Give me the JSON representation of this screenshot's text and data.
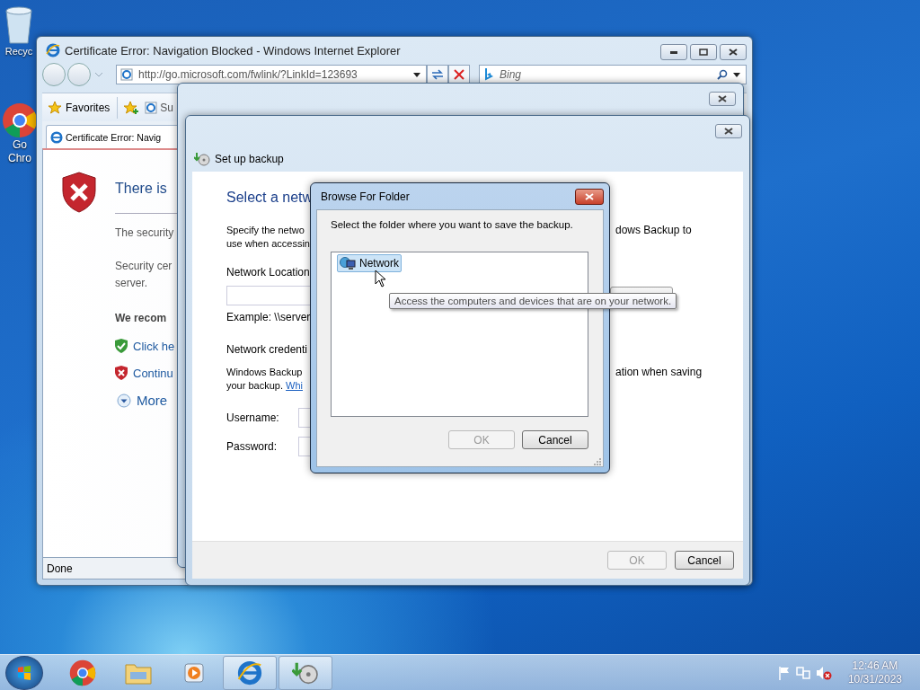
{
  "desktop": {
    "icons": [
      {
        "kind": "recycle",
        "lines": [
          "Recyc"
        ]
      },
      {
        "kind": "chrome",
        "lines": [
          "Go",
          "Chro"
        ]
      }
    ]
  },
  "browser": {
    "title": "Certificate Error: Navigation Blocked - Windows Internet Explorer",
    "address": "http://go.microsoft.com/fwlink/?LinkId=123693",
    "search": {
      "placeholder": "Bing"
    },
    "favorites": "Favorites",
    "favorites_items": [
      "Su"
    ],
    "tabs": [
      {
        "label": "Certificate Error: Navig",
        "selected": true
      }
    ],
    "page": {
      "heading": "There is",
      "paragraphs": [
        [
          "The security"
        ],
        [
          "Security cer",
          "server."
        ]
      ],
      "recommend": "We recom",
      "options": [
        {
          "kind": "safe",
          "text": "Click he"
        },
        {
          "kind": "unsafe",
          "text": "Continu"
        }
      ],
      "more": "More"
    },
    "status": "Done"
  },
  "backup_dialog": {
    "title": "Set up backup",
    "heading": "Select a netw",
    "intro": [
      "Specify the netwo",
      "use when accessin"
    ],
    "intro_right": "dows Backup to",
    "location_label": "Network Location",
    "example": "Example: \\\\server",
    "credentials_label": "Network credenti",
    "credentials_text": [
      "Windows Backup",
      "your backup."
    ],
    "credentials_link": "Whi",
    "credentials_right": "ation when saving",
    "username_label": "Username:",
    "password_label": "Password:",
    "buttons": [
      {
        "label": "OK",
        "disabled": true
      },
      {
        "label": "Cancel",
        "disabled": false
      }
    ]
  },
  "browse_dialog": {
    "title": "Browse For Folder",
    "instruction": "Select the folder where you want to save the backup.",
    "tree": [
      {
        "label": "Network",
        "selected": true
      }
    ],
    "tooltip": "Access the computers and devices that are on your network.",
    "buttons": [
      {
        "label": "OK",
        "disabled": true
      },
      {
        "label": "Cancel",
        "disabled": false
      }
    ]
  },
  "taskbar": {
    "apps": [
      {
        "kind": "chrome",
        "active": false
      },
      {
        "kind": "folder",
        "active": false
      },
      {
        "kind": "media",
        "active": false
      },
      {
        "kind": "ie",
        "active": true
      },
      {
        "kind": "backup",
        "active": true
      }
    ],
    "clock": {
      "time": "12:46 AM",
      "date": "10/31/2023"
    }
  }
}
